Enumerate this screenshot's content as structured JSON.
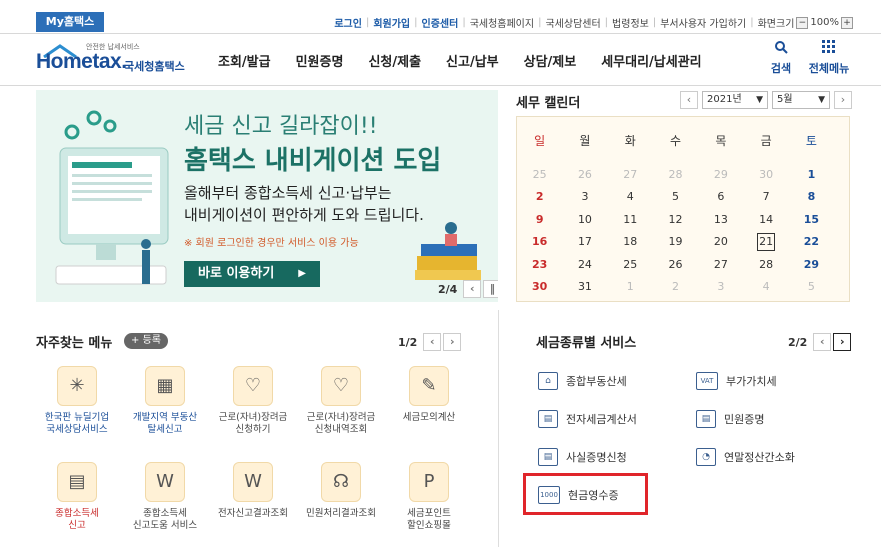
{
  "top": {
    "my_hometax": "My홈택스",
    "links": [
      "로그인",
      "회원가입",
      "인증센터",
      "국세청홈페이지",
      "국세상담센터",
      "법령정보",
      "부서사용자 가입하기",
      "화면크기"
    ],
    "zoom": "100%"
  },
  "logo": {
    "main": "Hometax.",
    "sub": "국세청홈택스",
    "tiny": "안전한 납세서비스"
  },
  "nav": [
    "조회/발급",
    "민원증명",
    "신청/제출",
    "신고/납부",
    "상담/제보",
    "세무대리/납세관리"
  ],
  "header_icons": {
    "search": "검색",
    "menu": "전체메뉴"
  },
  "banner": {
    "line1": "세금 신고 길라잡이!!",
    "line2": "홈택스 내비게이션 도입",
    "text1": "올해부터 종합소득세 신고·납부는",
    "text2": "내비게이션이 편안하게 도와 드립니다.",
    "note": "※ 회원 로그인한 경우만 서비스 이용 가능",
    "button": "바로 이용하기",
    "pager": "2/4"
  },
  "calendar": {
    "title": "세무 캘린더",
    "year": "2021년",
    "month": "5월",
    "weekdays": [
      "일",
      "월",
      "화",
      "수",
      "목",
      "금",
      "토"
    ],
    "weeks": [
      [
        "25",
        "26",
        "27",
        "28",
        "29",
        "30",
        "1"
      ],
      [
        "2",
        "3",
        "4",
        "5",
        "6",
        "7",
        "8"
      ],
      [
        "9",
        "10",
        "11",
        "12",
        "13",
        "14",
        "15"
      ],
      [
        "16",
        "17",
        "18",
        "19",
        "20",
        "21",
        "22"
      ],
      [
        "23",
        "24",
        "25",
        "26",
        "27",
        "28",
        "29"
      ],
      [
        "30",
        "31",
        "1",
        "2",
        "3",
        "4",
        "5"
      ]
    ],
    "today": "21"
  },
  "favorites": {
    "title": "자주찾는 메뉴",
    "register": "+ 등록",
    "pager": "1/2",
    "items": [
      {
        "label": "한국판 뉴딜기업\n국세상담서비스",
        "icon": "✳"
      },
      {
        "label": "개발지역 부동산\n탈세신고",
        "icon": "▦"
      },
      {
        "label": "근로(자녀)장려금\n신청하기",
        "icon": "♡"
      },
      {
        "label": "근로(자녀)장려금\n신청내역조회",
        "icon": "♡"
      },
      {
        "label": "세금모의계산",
        "icon": "✎"
      },
      {
        "label": "종합소득세\n신고",
        "icon": "▤"
      },
      {
        "label": "종합소득세\n신고도움 서비스",
        "icon": "W"
      },
      {
        "label": "전자신고결과조회",
        "icon": "W"
      },
      {
        "label": "민원처리결과조회",
        "icon": "☊"
      },
      {
        "label": "세금포인트\n할인쇼핑몰",
        "icon": "P"
      }
    ]
  },
  "tax_services": {
    "title": "세금종류별 서비스",
    "pager": "2/2",
    "items": [
      {
        "label": "종합부동산세",
        "icon": "⌂"
      },
      {
        "label": "부가가치세",
        "icon": "VAT"
      },
      {
        "label": "전자세금계산서",
        "icon": "▤"
      },
      {
        "label": "민원증명",
        "icon": "▤"
      },
      {
        "label": "사실증명신청",
        "icon": "▤"
      },
      {
        "label": "연말정산간소화",
        "icon": "◔"
      },
      {
        "label": "현금영수증",
        "icon": "1000"
      }
    ]
  }
}
